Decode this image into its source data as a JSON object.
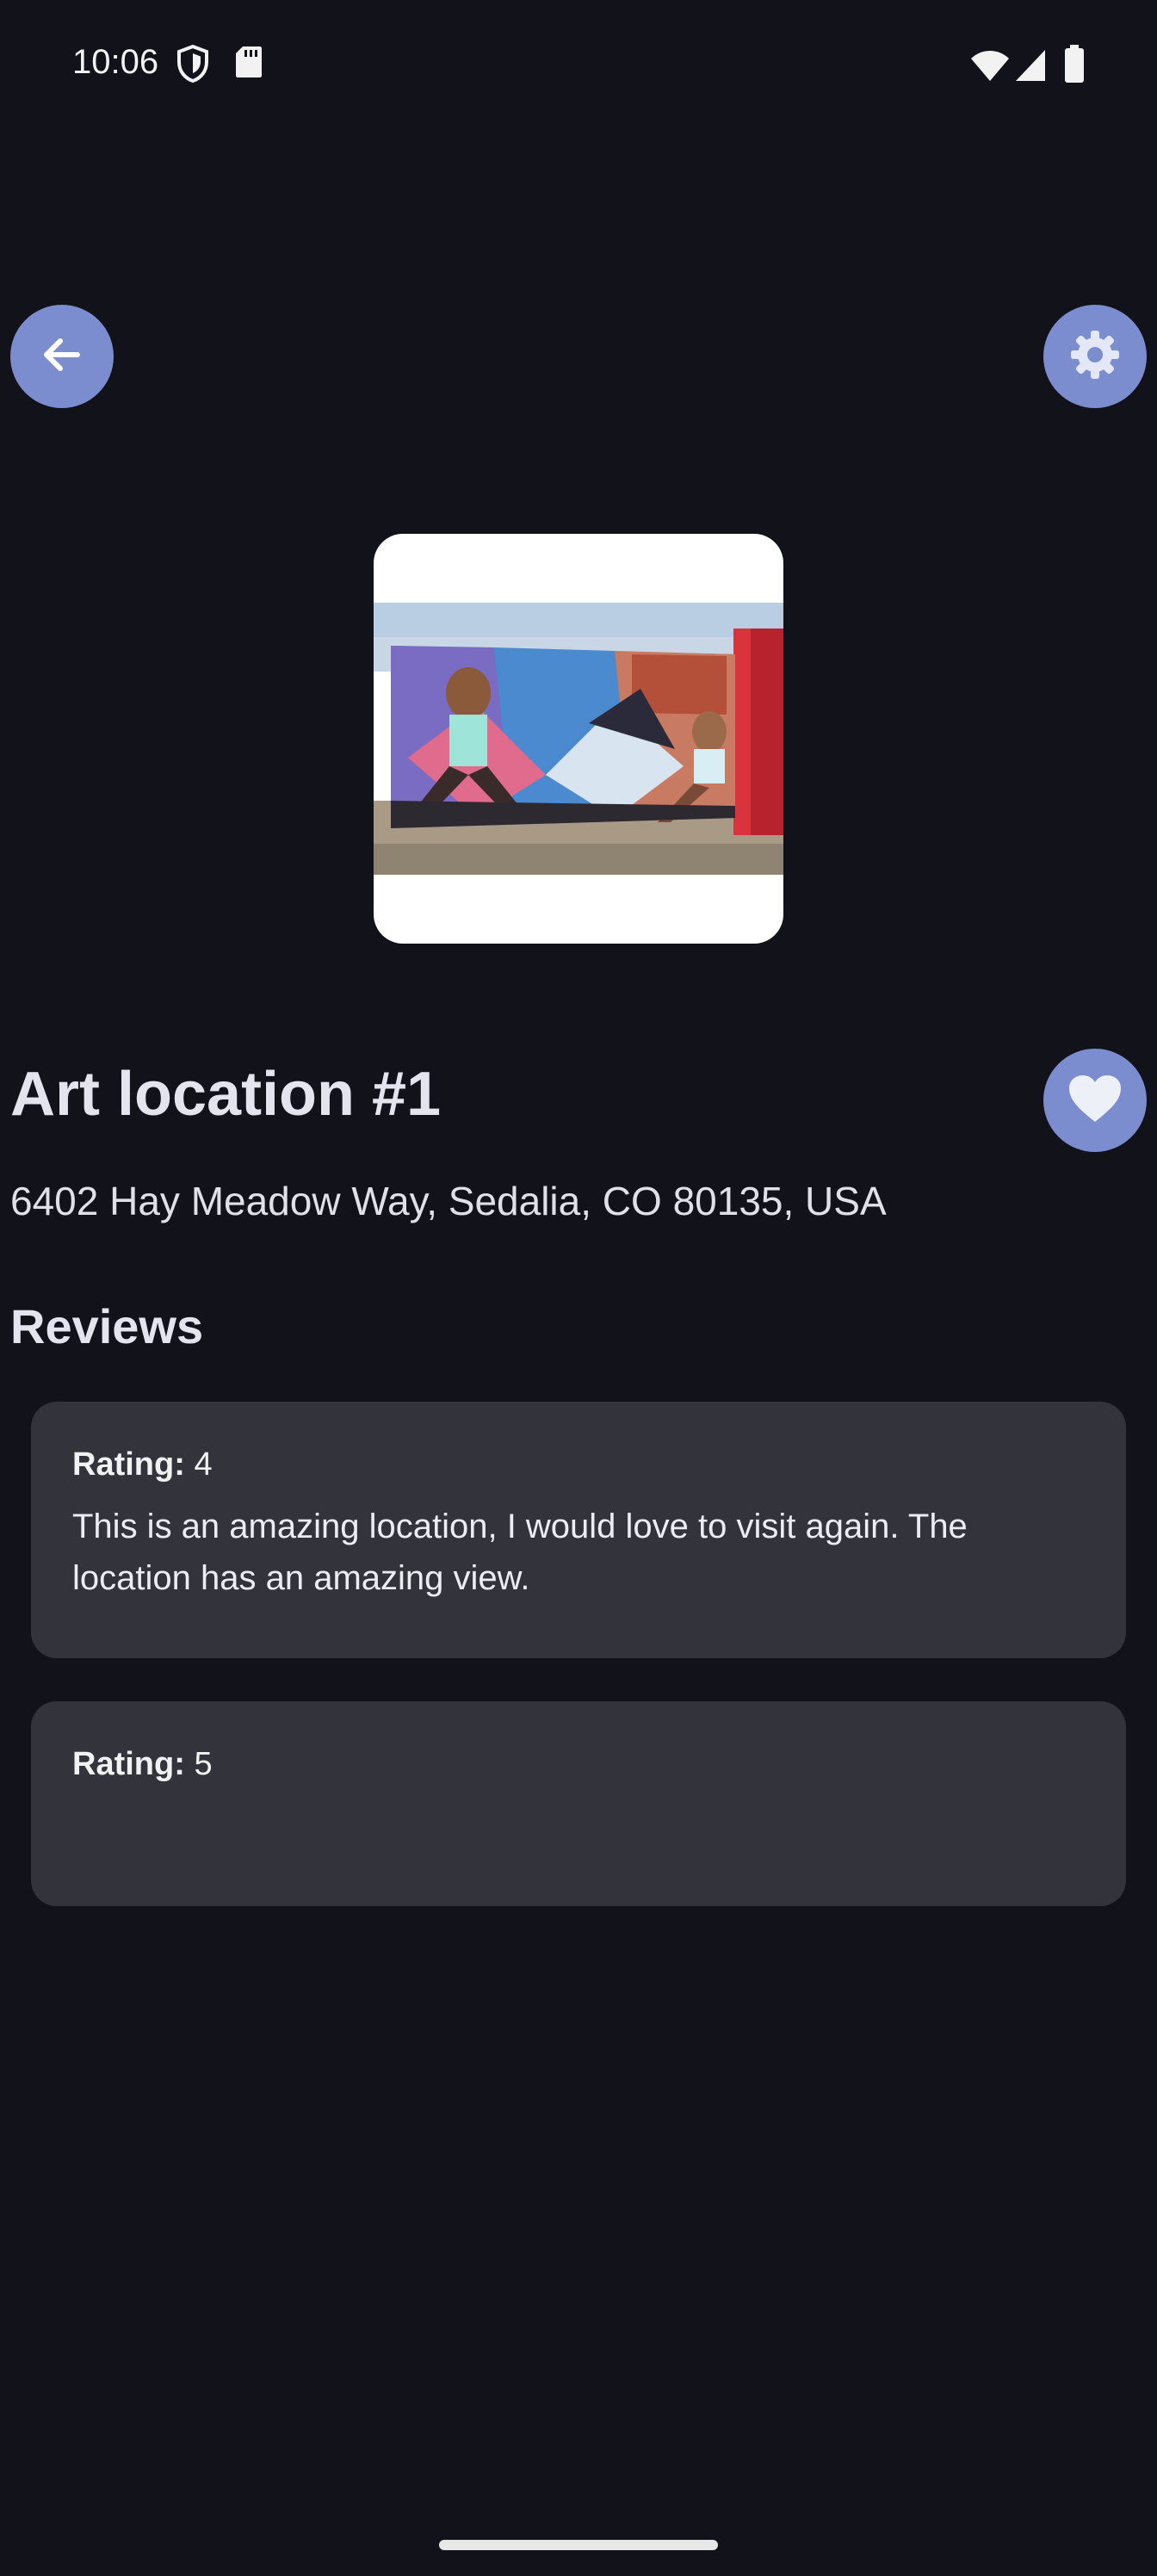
{
  "status_bar": {
    "time": "10:06",
    "icons": [
      "shield-icon",
      "sd-card-icon",
      "wifi-icon",
      "signal-icon",
      "battery-icon"
    ]
  },
  "toolbar": {
    "back_icon": "arrow-back-icon",
    "settings_icon": "gear-icon"
  },
  "location": {
    "title": "Art location #1",
    "address": "6402 Hay Meadow Way, Sedalia, CO 80135, USA",
    "favorite_icon": "heart-icon"
  },
  "reviews": {
    "heading": "Reviews",
    "rating_label": "Rating:",
    "items": [
      {
        "rating": "4",
        "text": "This is an amazing location, I would love to visit again. The location has an amazing view."
      },
      {
        "rating": "5",
        "text": ""
      }
    ]
  },
  "colors": {
    "background": "#12131a",
    "accent": "#7b8dcf",
    "card": "#33343b"
  }
}
